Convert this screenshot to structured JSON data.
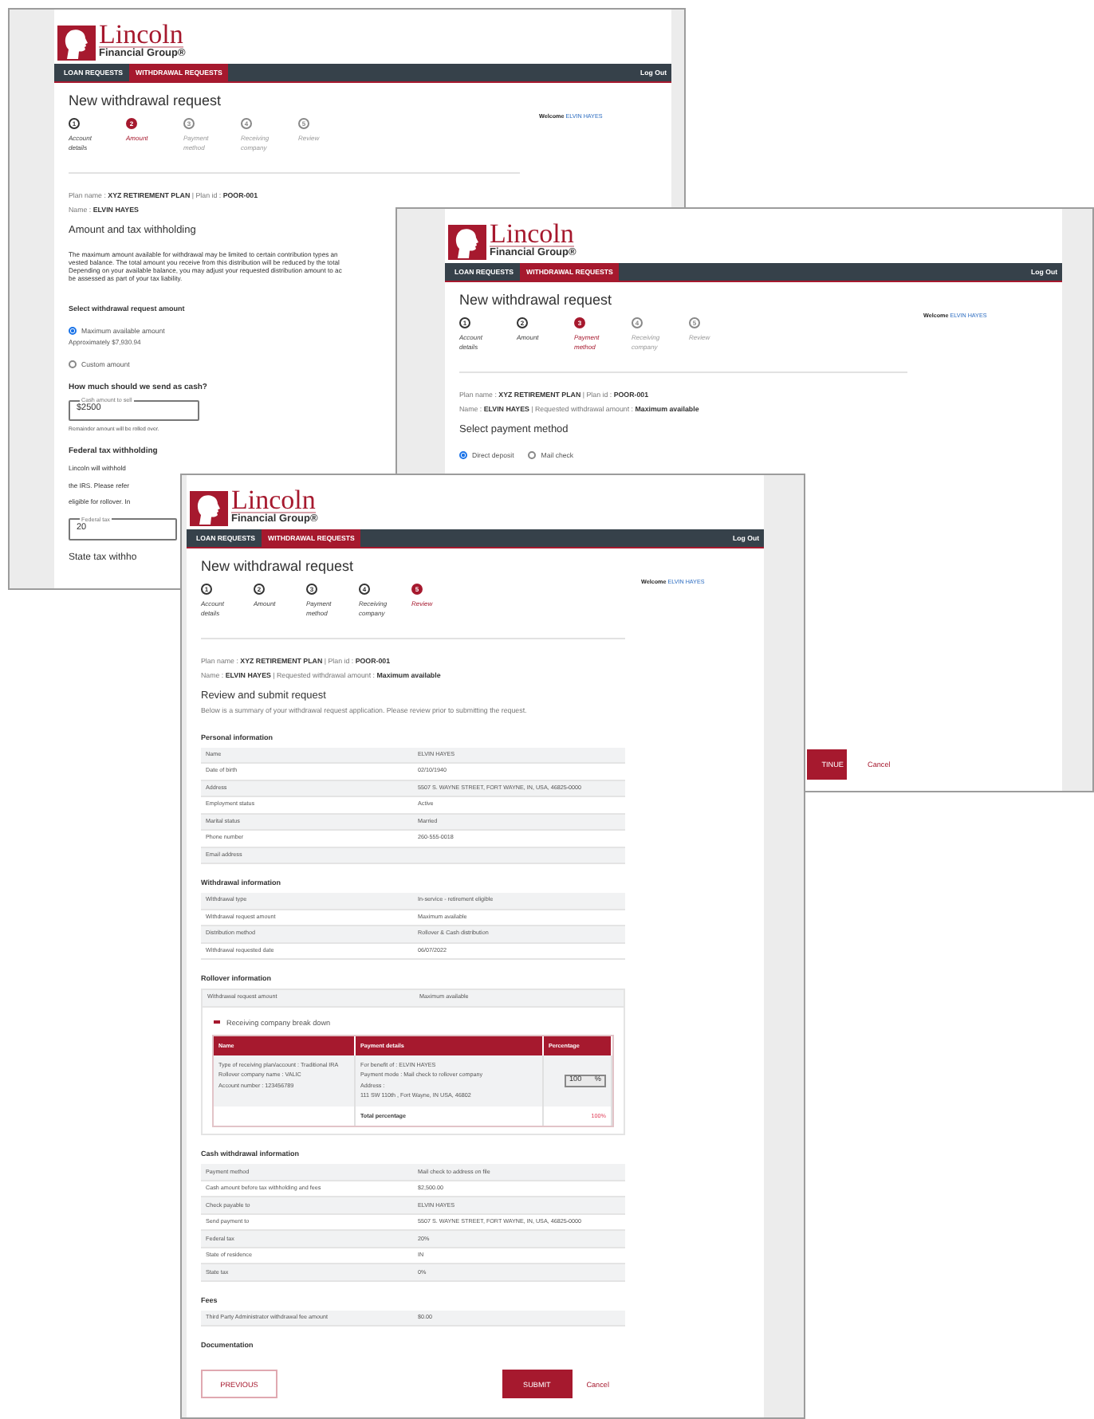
{
  "windows": [
    {
      "kind": "amount",
      "logo": {
        "name": "Lincoln",
        "tagline": "Financial Group®"
      },
      "nav": {
        "tabs": [
          {
            "label": "LOAN REQUESTS",
            "selected": false
          },
          {
            "label": "WITHDRAWAL REQUESTS",
            "selected": true
          }
        ],
        "logout": "Log Out"
      },
      "title": "New withdrawal request",
      "welcome": {
        "label": "Welcome",
        "name": "ELVIN HAYES"
      },
      "steps": [
        {
          "number": "1",
          "label": "Account details",
          "completed": true,
          "selected": false
        },
        {
          "number": "2",
          "label": "Amount",
          "completed": false,
          "selected": true
        },
        {
          "number": "3",
          "label": "Payment method",
          "completed": false,
          "selected": false
        },
        {
          "number": "4",
          "label": "Receiving company",
          "completed": false,
          "selected": false
        },
        {
          "number": "5",
          "label": "Review",
          "completed": false,
          "selected": false
        }
      ],
      "plan_lines": [
        "Plan name : **XYZ RETIREMENT PLAN**  |  Plan id : **POOR-001**",
        "Name : **ELVIN HAYES**"
      ],
      "heading": "Amount and tax withholding",
      "description_lines": [
        "The maximum amount available for withdrawal may be limited to certain contribution types an",
        "vested balance. The total amount you receive from this distribution will be reduced by the total",
        "Depending on your available balance, you may adjust your requested distribution amount to ac",
        "be assessed as part of your tax liability."
      ],
      "amount_label": "Select withdrawal request amount",
      "amount_options": [
        {
          "label": "Maximum available amount",
          "note": "Approximately $7,930.94",
          "selected": true
        },
        {
          "label": "Custom amount",
          "selected": false
        }
      ],
      "cash_question": "How much should we send as cash?",
      "cash_field": {
        "label": "Cash amount to sell",
        "value": "$2500"
      },
      "cash_hint": "Remainder amount will be rolled over.",
      "federal_heading": "Federal tax withholding",
      "federal_lines": [
        "Lincoln will withhold",
        "the IRS. Please refer",
        "eligible for rollover. In"
      ],
      "federal_field": {
        "label": "Federal tax",
        "value": "20"
      },
      "state_heading": "State tax withho"
    },
    {
      "kind": "payment",
      "logo": {
        "name": "Lincoln",
        "tagline": "Financial Group®"
      },
      "nav": {
        "tabs": [
          {
            "label": "LOAN REQUESTS",
            "selected": false
          },
          {
            "label": "WITHDRAWAL REQUESTS",
            "selected": true
          }
        ],
        "logout": "Log Out"
      },
      "title": "New withdrawal request",
      "welcome": {
        "label": "Welcome",
        "name": "ELVIN HAYES"
      },
      "steps": [
        {
          "number": "1",
          "label": "Account details",
          "completed": true,
          "selected": false
        },
        {
          "number": "2",
          "label": "Amount",
          "completed": true,
          "selected": false
        },
        {
          "number": "3",
          "label": "Payment method",
          "completed": false,
          "selected": true
        },
        {
          "number": "4",
          "label": "Receiving company",
          "completed": false,
          "selected": false
        },
        {
          "number": "5",
          "label": "Review",
          "completed": false,
          "selected": false
        }
      ],
      "plan_lines": [
        "Plan name : **XYZ RETIREMENT PLAN**  |  Plan id : **POOR-001**",
        "Name : **ELVIN HAYES**  |  Requested withdrawal amount : **Maximum available**"
      ],
      "heading": "Select payment method",
      "payment_options": [
        {
          "label": "Direct deposit",
          "selected": true
        },
        {
          "label": "Mail check",
          "selected": false
        }
      ],
      "continue_button": "TINUE",
      "cancel_link": "Cancel"
    },
    {
      "kind": "review",
      "logo": {
        "name": "Lincoln",
        "tagline": "Financial Group®"
      },
      "nav": {
        "tabs": [
          {
            "label": "LOAN REQUESTS",
            "selected": false
          },
          {
            "label": "WITHDRAWAL REQUESTS",
            "selected": true
          }
        ],
        "logout": "Log Out"
      },
      "title": "New withdrawal request",
      "welcome": {
        "label": "Welcome",
        "name": "ELVIN HAYES"
      },
      "steps": [
        {
          "number": "1",
          "label": "Account details",
          "completed": true,
          "selected": false
        },
        {
          "number": "2",
          "label": "Amount",
          "completed": true,
          "selected": false
        },
        {
          "number": "3",
          "label": "Payment method",
          "completed": true,
          "selected": false
        },
        {
          "number": "4",
          "label": "Receiving company",
          "completed": true,
          "selected": false
        },
        {
          "number": "5",
          "label": "Review",
          "completed": false,
          "selected": true
        }
      ],
      "plan_lines": [
        "Plan name : **XYZ RETIREMENT PLAN**  |  Plan id : **POOR-001**",
        "Name : **ELVIN HAYES**  |  Requested withdrawal amount : **Maximum available**"
      ],
      "heading": "Review and submit request",
      "intro": "Below is a summary of your withdrawal request application. Please review prior to submitting the request.",
      "sections": [
        {
          "kind": "table",
          "title": "Personal information",
          "rows": [
            {
              "label": "Name",
              "value": "ELVIN HAYES"
            },
            {
              "label": "Date of birth",
              "value": "02/10/1940"
            },
            {
              "label": "Address",
              "value": "5507 S. WAYNE STREET, FORT WAYNE, IN, USA, 46825-0000"
            },
            {
              "label": "Employment status",
              "value": "Active"
            },
            {
              "label": "Marital status",
              "value": "Married"
            },
            {
              "label": "Phone number",
              "value": "260-555-0018"
            },
            {
              "label": "Email address"
            }
          ]
        },
        {
          "kind": "table",
          "title": "Withdrawal information",
          "rows": [
            {
              "label": "Withdrawal type",
              "value": "In-service - retirement eligible"
            },
            {
              "label": "Withdrawal request amount",
              "value": "Maximum available"
            },
            {
              "label": "Distribution method",
              "value": "Rollover & Cash distribution"
            },
            {
              "label": "Withdrawal requested date",
              "value": "06/07/2022"
            }
          ]
        },
        {
          "kind": "rollover",
          "title": "Rollover information",
          "rows": [
            {
              "label": "Withdrawal request amount",
              "value": "Maximum available"
            }
          ],
          "breakdown": {
            "title": "Receiving company break down",
            "expanded": true,
            "columns": [
              "Name",
              "Payment details",
              "Percentage"
            ],
            "rows": [
              {
                "name_lines": [
                  "Type of receiving plan/account : Traditional IRA",
                  "Rollover company name : VALIC",
                  "Account number : 123456789"
                ],
                "detail_lines": [
                  "For benefit of : ELVIN HAYES",
                  "Payment mode : Mail check to rollover company",
                  "Address :",
                  "111 SW 110th , Fort Wayne, IN USA, 46802"
                ],
                "percentage": "100",
                "unit": "%"
              }
            ],
            "total_label": "Total percentage",
            "total_value": "100%"
          }
        },
        {
          "kind": "table",
          "title": "Cash withdrawal information",
          "rows": [
            {
              "label": "Payment method",
              "value": "Mail check to address on file"
            },
            {
              "label": "Cash amount before tax withholding and fees",
              "value": "$2,500.00"
            },
            {
              "label": "Check payable to",
              "value": "ELVIN HAYES"
            },
            {
              "label": "Send payment to",
              "value": "5507 S. WAYNE STREET, FORT WAYNE, IN, USA, 46825-0000"
            },
            {
              "label": "Federal tax",
              "value": "20%"
            },
            {
              "label": "State of residence",
              "value": "IN"
            },
            {
              "label": "State tax",
              "value": "0%"
            }
          ]
        },
        {
          "kind": "table",
          "title": "Fees",
          "rows": [
            {
              "label": "Third Party Administrator withdrawal fee amount",
              "value": "$0.00"
            }
          ]
        },
        {
          "kind": "heading",
          "title": "Documentation"
        }
      ],
      "previous_button": "PREVIOUS",
      "submit_button": "SUBMIT",
      "cancel_link": "Cancel"
    }
  ]
}
